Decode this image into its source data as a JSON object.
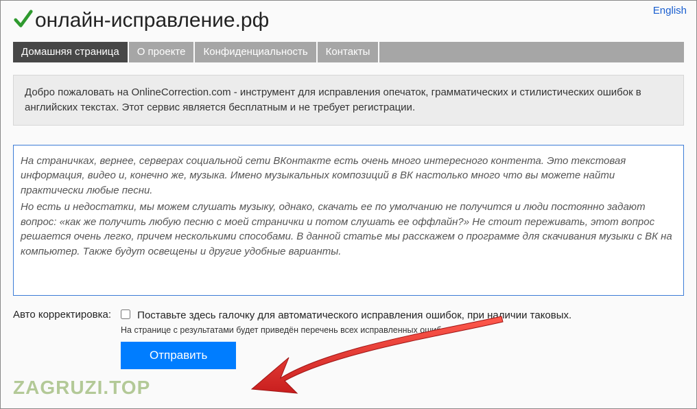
{
  "lang_link": "English",
  "site_title": "онлайн-исправление.рф",
  "nav": {
    "items": [
      {
        "label": "Домашняя страница",
        "active": true
      },
      {
        "label": "О проекте",
        "active": false
      },
      {
        "label": "Конфиденциальность",
        "active": false
      },
      {
        "label": "Контакты",
        "active": false
      }
    ]
  },
  "welcome": "Добро пожаловать на OnlineCorrection.com - инструмент для исправления опечаток, грамматических и стилистических ошибок в английских текстах. Этот сервис является бесплатным и не требует регистрации.",
  "editor": {
    "p1": "На страничках, вернее, серверах социальной сети ВКонтакте есть очень много интересного контента. Это текстовая информация, видео и, конечно же, музыка. Имено музыкальных композиций в ВК настолько много что вы можете найти практически любые песни.",
    "p2": "Но есть и недостатки, мы можем слушать музыку, однако, скачать ее по умолчанию не получится и люди постоянно задают вопрос: «как же получить любую песню с моей странички и потом слушать ее оффлайн?» Не стоит переживать, этот вопрос решается очень легко, причем несколькими способами. В данной статье мы расскажем о программе для скачивания музыки с ВК на компьютер. Также будут освещены и другие удобные варианты."
  },
  "auto": {
    "label": "Авто корректировка:",
    "checkbox_text": "Поставьте здесь галочку для автоматического исправления ошибок, при наличии таковых.",
    "hint": "На странице с результатами будет приведён перечень всех исправленных ошибок."
  },
  "submit_label": "Отправить",
  "watermark": "ZAGRUZI.TOP"
}
